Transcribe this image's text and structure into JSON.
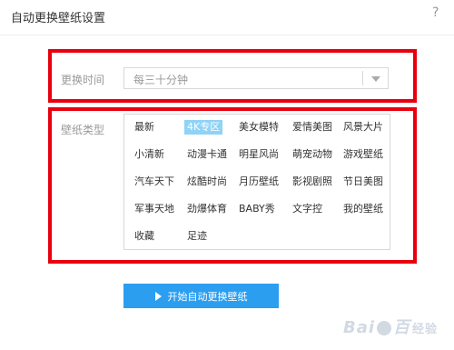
{
  "dialog": {
    "title": "自动更换壁纸设置",
    "close_glyph": "?"
  },
  "interval": {
    "label": "更换时间",
    "selected": "每三十分钟"
  },
  "categories": {
    "label": "壁纸类型",
    "selected": "4K专区",
    "items": [
      "最新",
      "4K专区",
      "美女模特",
      "爱情美图",
      "风景大片",
      "小清新",
      "动漫卡通",
      "明星风尚",
      "萌宠动物",
      "游戏壁纸",
      "汽车天下",
      "炫酷时尚",
      "月历壁纸",
      "影视剧照",
      "节日美图",
      "军事天地",
      "劲爆体育",
      "BABY秀",
      "文字控",
      "我的壁纸",
      "收藏",
      "足迹"
    ]
  },
  "start_button": {
    "label": "开始自动更换壁纸"
  },
  "watermark": {
    "logo": "Bai",
    "logo2": "百",
    "sub": "经验"
  },
  "colors": {
    "highlight": "#e8000f",
    "accent": "#2b9ef0",
    "selected_item_bg": "#8fd3f7"
  }
}
